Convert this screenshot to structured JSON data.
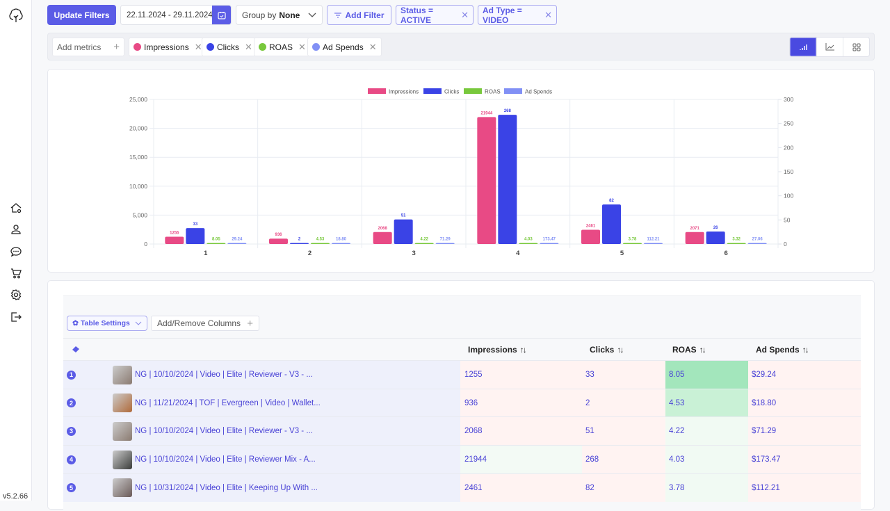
{
  "sidebar": {
    "logo": "tree-logo",
    "items": [
      {
        "name": "home",
        "icon": "home-gear-icon"
      },
      {
        "name": "users",
        "icon": "user-icon"
      },
      {
        "name": "messages",
        "icon": "chat-icon"
      },
      {
        "name": "orders",
        "icon": "cart-icon"
      },
      {
        "name": "settings",
        "icon": "gear-icon"
      },
      {
        "name": "logout",
        "icon": "logout-icon"
      }
    ],
    "version": "v5.2.66"
  },
  "topbar": {
    "update_label": "Update Filters",
    "date_range": "22.11.2024 - 29.11.2024",
    "group_by_label": "Group by",
    "group_by_value": "None",
    "add_filter_label": "Add Filter",
    "filters": [
      "Status = ACTIVE",
      "Ad Type = VIDEO"
    ]
  },
  "metrics": {
    "add_label": "Add metrics",
    "items": [
      {
        "label": "Impressions",
        "color": "#e84a85"
      },
      {
        "label": "Clicks",
        "color": "#3a43e6"
      },
      {
        "label": "ROAS",
        "color": "#78c83c"
      },
      {
        "label": "Ad Spends",
        "color": "#8190f5"
      }
    ],
    "views": [
      "bar-chart",
      "line-chart",
      "grid"
    ],
    "active_view": "bar-chart"
  },
  "chart_data": {
    "type": "bar",
    "title": "",
    "xlabel": "",
    "ylabel": "",
    "categories": [
      "1",
      "2",
      "3",
      "4",
      "5",
      "6"
    ],
    "legend_position": "top-center",
    "grid": true,
    "left_axis": {
      "ylim": [
        0,
        25000
      ],
      "ticks": [
        "0",
        "5,000",
        "10,000",
        "15,000",
        "20,000",
        "25,000"
      ]
    },
    "right_axis": {
      "ylim": [
        0,
        300
      ],
      "ticks": [
        "0",
        "50",
        "100",
        "150",
        "200",
        "250",
        "300"
      ]
    },
    "series": [
      {
        "name": "Impressions",
        "color": "#e84a85",
        "axis": "left",
        "values": [
          1255,
          936,
          2068,
          21944,
          2461,
          2071
        ],
        "labels": [
          "1255",
          "936",
          "2068",
          "21944",
          "2461",
          "2071"
        ]
      },
      {
        "name": "Clicks",
        "color": "#3a43e6",
        "axis": "right",
        "values": [
          33,
          2,
          51,
          268,
          82,
          26
        ],
        "labels": [
          "33",
          "2",
          "51",
          "268",
          "82",
          "26"
        ]
      },
      {
        "name": "ROAS",
        "color": "#78c83c",
        "axis": "left",
        "values": [
          8.05,
          4.53,
          4.22,
          4.03,
          3.78,
          3.32
        ],
        "labels": [
          "8.05",
          "4.53",
          "4.22",
          "4.03",
          "3.78",
          "3.32"
        ]
      },
      {
        "name": "Ad Spends",
        "color": "#8190f5",
        "axis": "left",
        "values": [
          29.24,
          18.8,
          71.29,
          173.47,
          112.21,
          27.06
        ],
        "labels": [
          "29.24",
          "18.80",
          "71.29",
          "173.47",
          "112.21",
          "27.06"
        ]
      }
    ]
  },
  "table": {
    "settings_label": "Table Settings",
    "columns_label": "Add/Remove Columns",
    "headers": [
      "Impressions",
      "Clicks",
      "ROAS",
      "Ad Spends"
    ],
    "sort_glyph": "↑↓",
    "rows": [
      {
        "n": "1",
        "name": "NG | 10/10/2024 | Video | Elite | Reviewer - V3 - ...",
        "impressions": "1255",
        "clicks": "33",
        "roas": "8.05",
        "spend": "$29.24",
        "thumb": "#8a7a70"
      },
      {
        "n": "2",
        "name": "NG | 11/21/2024 | TOF | Evergreen | Video | Wallet...",
        "impressions": "936",
        "clicks": "2",
        "roas": "4.53",
        "spend": "$18.80",
        "thumb": "#b06a3a"
      },
      {
        "n": "3",
        "name": "NG | 10/10/2024 | Video | Elite | Reviewer - V3 - ...",
        "impressions": "2068",
        "clicks": "51",
        "roas": "4.22",
        "spend": "$71.29",
        "thumb": "#8a7a70"
      },
      {
        "n": "4",
        "name": "NG | 10/10/2024 | Video | Elite | Reviewer Mix - A...",
        "impressions": "21944",
        "clicks": "268",
        "roas": "4.03",
        "spend": "$173.47",
        "thumb": "#3a3c3a"
      },
      {
        "n": "5",
        "name": "NG | 10/31/2024 | Video | Elite | Keeping Up With ...",
        "impressions": "2461",
        "clicks": "82",
        "roas": "3.78",
        "spend": "$112.21",
        "thumb": "#6a5a58"
      }
    ],
    "cell_colors": {
      "impressions": [
        "#fff3f2",
        "#fff3f2",
        "#fff3f2",
        "#f3faf5",
        "#fff3f2"
      ],
      "clicks": [
        "#fff3f2",
        "#fff3f2",
        "#fff3f2",
        "#fff3f2",
        "#fff3f2"
      ],
      "roas": [
        "#a3e6bc",
        "#c9f1d6",
        "#f1faf3",
        "#f1faf3",
        "#f1faf3"
      ],
      "spend": [
        "#fff3f2",
        "#fff3f2",
        "#fff3f2",
        "#fff3f2",
        "#fff3f2"
      ]
    }
  }
}
